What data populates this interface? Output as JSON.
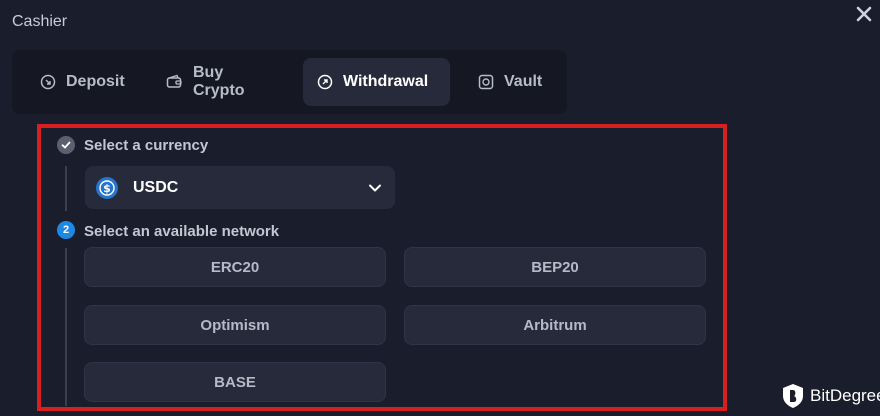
{
  "window": {
    "title": "Cashier"
  },
  "tabs": [
    {
      "label": "Deposit",
      "icon": "deposit-icon"
    },
    {
      "label": "Buy Crypto",
      "icon": "wallet-icon"
    },
    {
      "label": "Withdrawal",
      "icon": "withdrawal-icon",
      "active": true
    },
    {
      "label": "Vault",
      "icon": "vault-icon"
    }
  ],
  "steps": {
    "currency": {
      "label": "Select a currency",
      "status": "complete"
    },
    "network": {
      "label": "Select an available network",
      "number": "2"
    }
  },
  "currency_select": {
    "value": "USDC",
    "icon": "usdc-icon"
  },
  "networks": [
    "ERC20",
    "BEP20",
    "Optimism",
    "Arbitrum",
    "BASE"
  ],
  "brand": {
    "name": "BitDegree"
  },
  "colors": {
    "background": "#1a1d2b",
    "highlight_border": "#d5201f",
    "step_active": "#1e88e5",
    "step_done": "#5b6070",
    "usdc": "#2775ca"
  }
}
